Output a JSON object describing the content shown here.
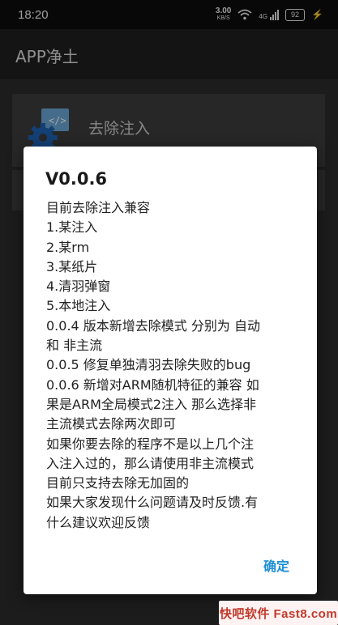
{
  "status_bar": {
    "time": "18:20",
    "net_speed_value": "3.00",
    "net_speed_unit": "KB/S",
    "signal": "4G",
    "battery": "92"
  },
  "app_bar": {
    "title": "APP净土"
  },
  "list": {
    "items": [
      {
        "label": "去除注入",
        "icon": "gear-code-icon"
      }
    ]
  },
  "dialog": {
    "title": "V0.0.6",
    "lines": [
      "目前去除注入兼容",
      "1.某注入",
      "2.某rm",
      "3.某纸片",
      "4.清羽弹窗",
      "5.本地注入",
      "0.0.4 版本新增去除模式 分别为 自动",
      "和 非主流",
      "0.0.5 修复单独清羽去除失败的bug",
      "0.0.6 新增对ARM随机特征的兼容 如",
      "果是ARM全局模式2注入 那么选择非",
      "主流模式去除两次即可",
      "如果你要去除的程序不是以上几个注",
      "入注入过的，那么请使用非主流模式",
      "目前只支持去除无加固的",
      "如果大家发现什么问题请及时反馈.有",
      "什么建议欢迎反馈"
    ],
    "confirm_label": "确定"
  },
  "watermark": {
    "text": "快吧软件 Fast8.com"
  },
  "colors": {
    "accent": "#1c8fd6",
    "app_bar": "#1f1f1f",
    "dialog_bg": "#ffffff"
  }
}
